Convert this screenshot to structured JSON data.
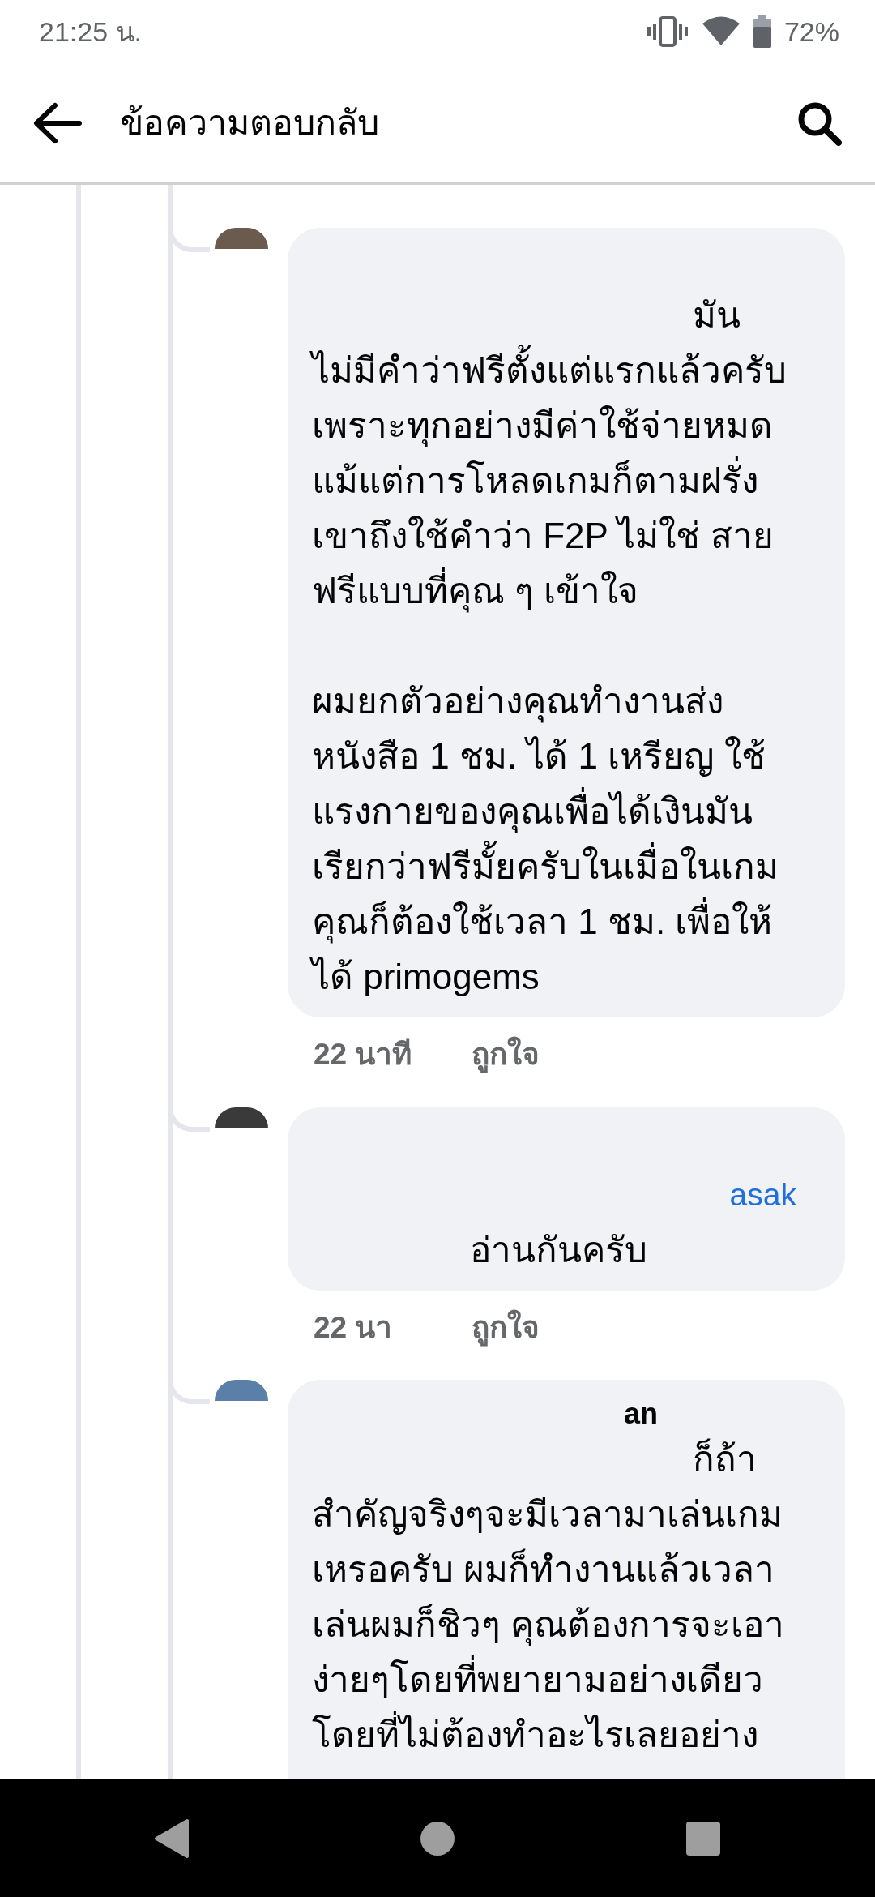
{
  "status_bar": {
    "time": "21:25 น.",
    "battery": "72%"
  },
  "header": {
    "title": "ข้อความตอบกลับ"
  },
  "comments": [
    {
      "text": "มัน\nไม่มีคำว่าฟรีตั้งแต่แรกแล้วครับ\nเพราะทุกอย่างมีค่าใช้จ่ายหมด\nแม้แต่การโหลดเกมก็ตามฝรั่ง\nเขาถึงใช้คำว่า F2P ไม่ใช่ สาย\nฟรีแบบที่คุณ ๆ เข้าใจ\n\nผมยกตัวอย่างคุณทำงานส่ง\nหนังสือ 1 ชม. ได้ 1 เหรียญ ใช้\nแรงกายของคุณเพื่อได้เงินมัน\nเรียกว่าฟรีมั้ยครับในเมื่อในเกม\nคุณก็ต้องใช้เวลา 1 ชม. เพื่อให้\nได้ primogems",
      "time": "22 นาที",
      "like": "ถูกใจ"
    },
    {
      "mention": "asak",
      "text": "อ่านกันครับ",
      "time": "22 นา",
      "like": "ถูกใจ"
    },
    {
      "author": "an",
      "text": "ก็ถ้า\nสำคัญจริงๆจะมีเวลามาเล่นเกม\nเหรอครับ ผมก็ทำงานแล้วเวลา\nเล่นผมก็ชิวๆ คุณต้องการจะเอา\nง่ายๆโดยที่พยายามอย่างเดียว\nโดยที่ไม่ต้องทำอะไรเลยอย่าง"
    }
  ]
}
